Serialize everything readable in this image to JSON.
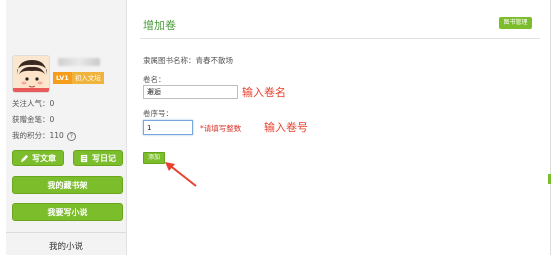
{
  "user": {
    "level": "LV1",
    "level_title": "初入文坛",
    "followers_label": "关注人气：0",
    "coins_label": "获赠金笔：0",
    "points_label": "我的积分：110",
    "help_icon": "?"
  },
  "sidebar": {
    "write_article": "写文章",
    "write_diary": "写日记",
    "my_bookshelf": "我的藏书架",
    "write_novel": "我要写小说",
    "section_title": "我的小说"
  },
  "main": {
    "title": "增加卷",
    "manage_button": "图书管理",
    "book_name_line": "隶属图书名称：青春不散场",
    "volume_name_label": "卷名：",
    "volume_name_value": "邂逅",
    "volume_name_annotation": "输入卷名",
    "volume_order_label": "卷序号：",
    "volume_order_value": "1",
    "volume_order_hint": "*请填写整数",
    "volume_order_annotation": "输入卷号",
    "submit_label": "添加"
  },
  "colors": {
    "accent_green": "#7bbd2a",
    "title_green": "#4a9a3a",
    "annotation_red": "#e8412f",
    "level_orange": "#f59c1a"
  },
  "icons": [
    "pencil-icon",
    "diary-icon",
    "help-icon",
    "arrow-annotation-icon"
  ]
}
